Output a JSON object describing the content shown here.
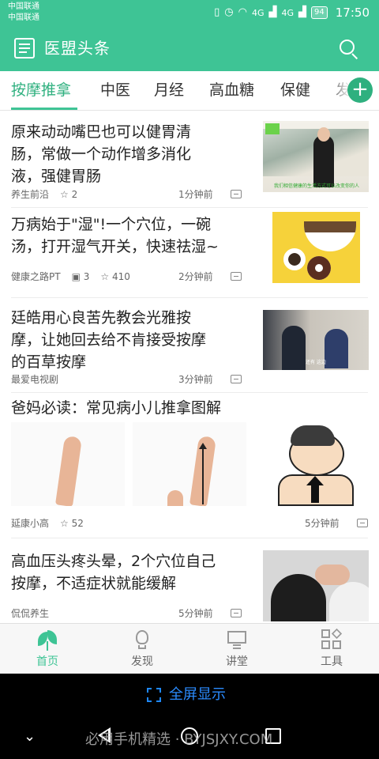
{
  "status_bar": {
    "carrier1": "中国联通",
    "carrier2": "中国联通",
    "signal1": "4G",
    "signal2": "4G",
    "battery": "94",
    "time": "17:50"
  },
  "header": {
    "title": "医盟头条",
    "icons": [
      "newspaper-icon",
      "search-icon"
    ]
  },
  "tabs": [
    {
      "label": "按摩推拿",
      "active": true
    },
    {
      "label": "中医"
    },
    {
      "label": "月经"
    },
    {
      "label": "高血糖"
    },
    {
      "label": "保健"
    },
    {
      "label": "发"
    }
  ],
  "articles": [
    {
      "title_lines": [
        "原来动动嘴巴也可以健胃清",
        "肠，常做一个动作增多消化",
        "液，强健胃肠"
      ],
      "source": "养生前沿",
      "stars": "☆ 2",
      "time": "1分钟前"
    },
    {
      "title_lines": [
        "万病始于\"湿\"!一个穴位，一碗",
        "汤，打开湿气开关，快速祛湿~"
      ],
      "source": "健康之路PT",
      "comments": "▣ 3",
      "stars": "☆ 410",
      "time": "2分钟前"
    },
    {
      "title_lines": [
        "廷皓用心良苦先教会光雅按",
        "摩，让她回去给不肯接受按摩",
        "的百草按摩"
      ],
      "source": "最爱电视剧",
      "time": "3分钟前"
    },
    {
      "title_lines": [
        "爸妈必读：常见病小儿推拿图解"
      ],
      "source": "延康小高",
      "stars": "☆ 52",
      "time": "5分钟前"
    },
    {
      "title_lines": [
        "高血压头疼头晕，2个穴位自己",
        "按摩，不适症状就能缓解"
      ],
      "source": "侃侃养生",
      "time": "5分钟前"
    }
  ],
  "thumb_text": {
    "caption1": "我们相信健康的生活方式可以改变你的人",
    "caption3": "还有 这边"
  },
  "bottom_nav": [
    {
      "label": "首页",
      "active": true
    },
    {
      "label": "发现"
    },
    {
      "label": "讲堂"
    },
    {
      "label": "工具"
    }
  ],
  "fullscreen": {
    "label": "全屏显示"
  },
  "watermark": "必用手机精选 · BYJSJXY.COM",
  "colors": {
    "accent": "#3ec495",
    "link_blue": "#2b8cff"
  }
}
